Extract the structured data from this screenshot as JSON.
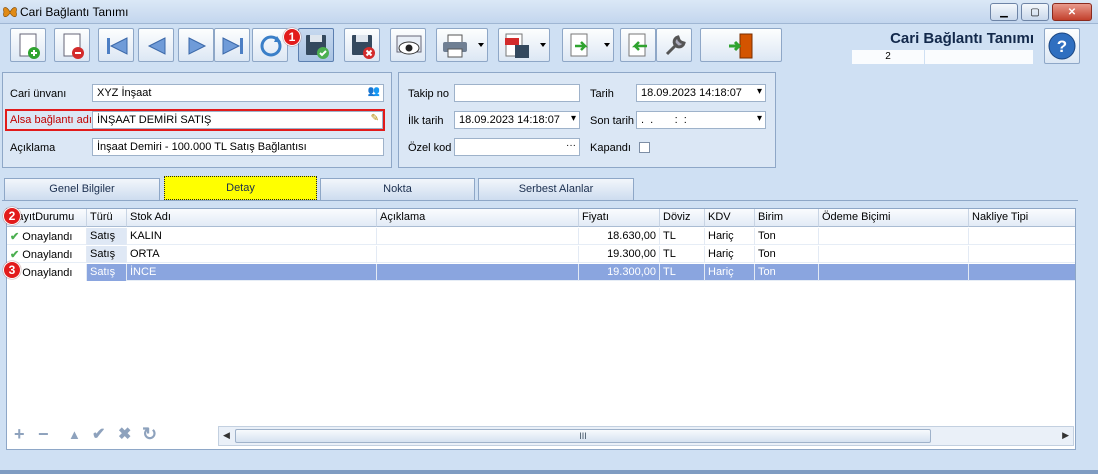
{
  "window": {
    "title": "Cari Bağlantı Tanımı",
    "minimize": "▁",
    "maximize": "▢",
    "close": "✕"
  },
  "header": {
    "title": "Cari Bağlantı Tanımı",
    "counter": "2"
  },
  "badges": {
    "save": "1",
    "header_row": "2",
    "selected_row": "3"
  },
  "form_left": {
    "cari_unvani_label": "Cari ünvanı",
    "cari_unvani_value": "XYZ İnşaat",
    "alsa_label": "Alsa bağlantı adı",
    "alsa_value": "İNŞAAT DEMİRİ SATIŞ",
    "aciklama_label": "Açıklama",
    "aciklama_value": "İnşaat Demiri - 100.000 TL Satış Bağlantısı"
  },
  "form_right": {
    "takip_label": "Takip no",
    "takip_value": "",
    "tarih_label": "Tarih",
    "tarih_value": "18.09.2023 14:18:07",
    "ilk_tarih_label": "İlk tarih",
    "ilk_tarih_value": "18.09.2023 14:18:07",
    "son_tarih_label": "Son tarih",
    "son_tarih_value": ".  .       :  :",
    "ozel_kod_label": "Özel kod",
    "ozel_kod_value": "",
    "ozel_kod_btn": "···",
    "kapandi_label": "Kapandı"
  },
  "tabs": [
    "Genel Bilgiler",
    "Detay",
    "Nokta",
    "Serbest Alanlar"
  ],
  "grid": {
    "columns": [
      "KayıtDurumu",
      "Türü",
      "Stok Adı",
      "Açıklama",
      "Fiyatı",
      "Döviz",
      "KDV",
      "Birim",
      "Ödeme Biçimi",
      "Nakliye Tipi"
    ],
    "rows": [
      {
        "durum": "Onaylandı",
        "turu": "Satış",
        "stok": "KALIN",
        "aciklama": "",
        "fiyat": "18.630,00",
        "doviz": "TL",
        "kdv": "Hariç",
        "birim": "Ton",
        "odeme": "",
        "nakliye": ""
      },
      {
        "durum": "Onaylandı",
        "turu": "Satış",
        "stok": "ORTA",
        "aciklama": "",
        "fiyat": "19.300,00",
        "doviz": "TL",
        "kdv": "Hariç",
        "birim": "Ton",
        "odeme": "",
        "nakliye": ""
      },
      {
        "durum": "Onaylandı",
        "turu": "Satış",
        "stok": "İNCE",
        "aciklama": "",
        "fiyat": "19.300,00",
        "doviz": "TL",
        "kdv": "Hariç",
        "birim": "Ton",
        "odeme": "",
        "nakliye": ""
      }
    ]
  },
  "navigator": {
    "add": "+",
    "remove": "−",
    "up": "▲",
    "post": "✔",
    "cancel": "✖",
    "refresh": "↻"
  },
  "scroll": {
    "left": "◀",
    "right": "▶",
    "grip": "III"
  },
  "colors": {
    "accent": "#e21b1b",
    "selection": "#8aa5df",
    "active_tab": "#ffff00"
  }
}
